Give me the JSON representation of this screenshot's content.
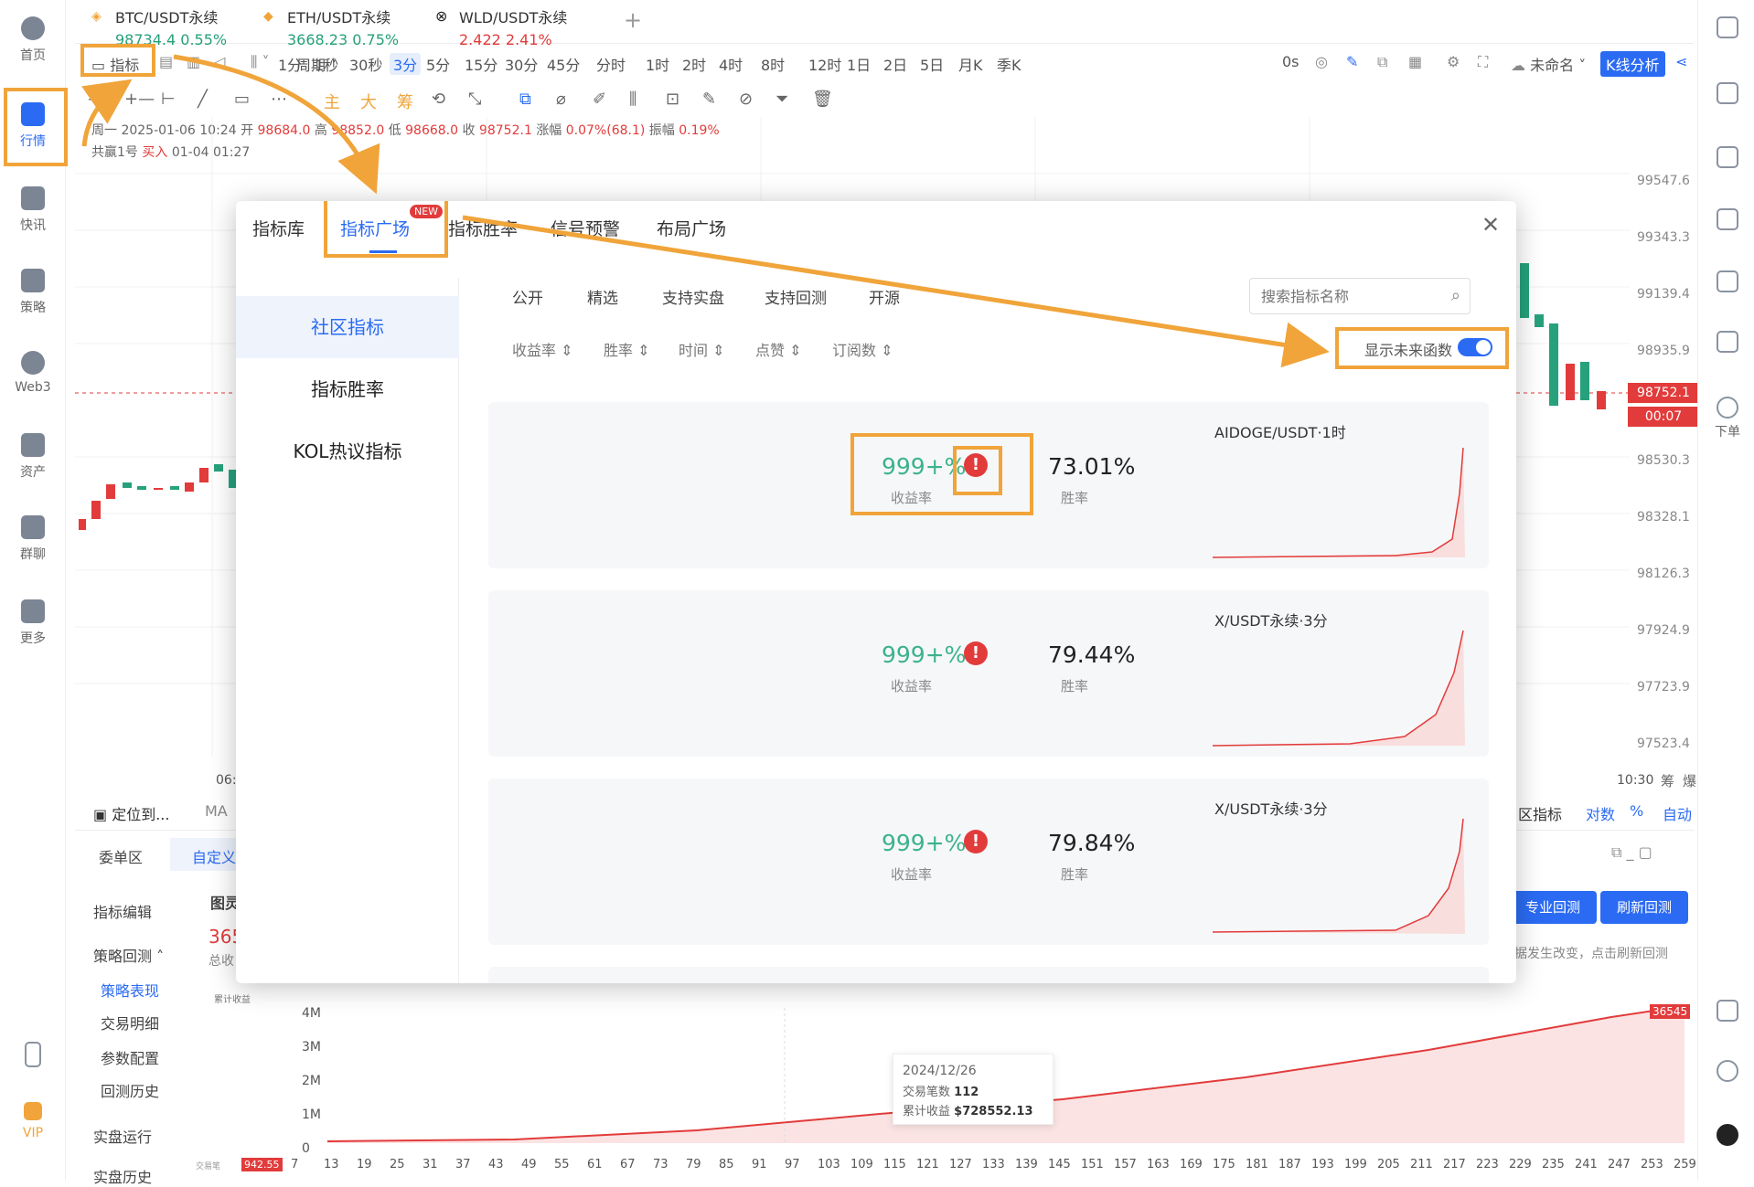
{
  "nav": [
    {
      "label": "首页"
    },
    {
      "label": "行情"
    },
    {
      "label": "快讯"
    },
    {
      "label": "策略"
    },
    {
      "label": "Web3"
    },
    {
      "label": "资产"
    },
    {
      "label": "群聊"
    },
    {
      "label": "更多"
    },
    {
      "label": "VIP"
    }
  ],
  "tabs": [
    {
      "name": "BTC/USDT永续",
      "price": "98734.4",
      "change": "0.55%"
    },
    {
      "name": "ETH/USDT永续",
      "price": "3668.23",
      "change": "0.75%"
    },
    {
      "name": "WLD/USDT永续",
      "price": "2.422",
      "change": "2.41%"
    }
  ],
  "toolbar": {
    "indicator": "指标",
    "period": "周期",
    "intervals": [
      "1分",
      "1秒",
      "30秒",
      "3分",
      "5分",
      "15分",
      "30分",
      "45分",
      "分时",
      "1时",
      "2时",
      "4时",
      "8时",
      "12时",
      "1日",
      "2日",
      "5日",
      "月K",
      "季K"
    ],
    "countdown": "0s",
    "unnamed": "未命名",
    "kline": "K线分析"
  },
  "toolbar2": {
    "zhu": "主",
    "da": "大",
    "chou": "筹"
  },
  "info": {
    "line1_date": "周一 2025-01-06 10:24",
    "open_label": "开",
    "open": "98684.0",
    "high_label": "高",
    "high": "98852.0",
    "low_label": "低",
    "low": "98668.0",
    "close_label": "收",
    "close": "98752.1",
    "chg_label": "涨幅",
    "chg": "0.07%(68.1)",
    "amp_label": "振幅",
    "amp": "0.19%",
    "line2": "共赢1号",
    "buy": "买入",
    "line2_date": "01-04 01:27"
  },
  "axis": {
    "prices": [
      "99547.6",
      "99343.3",
      "99139.4",
      "98935.9",
      "98530.3",
      "98328.1",
      "98126.3",
      "97924.9",
      "97723.9",
      "97523.4"
    ],
    "current": "98752.1",
    "timer": "00:07",
    "time_left": "06:",
    "time_right": "10:30",
    "chou": "筹",
    "bao": "爆"
  },
  "chart_footer": {
    "locate": "定位到...",
    "ma": "MA",
    "community": "区指标",
    "log": "对数",
    "pct": "%",
    "auto": "自动"
  },
  "bottom": {
    "tab1": "委单区",
    "tab2": "自定义",
    "edit": "指标编辑",
    "backtest": "策略回测",
    "perf": "策略表现",
    "trades": "交易明细",
    "params": "参数配置",
    "history": "回测历史",
    "live": "实盘运行",
    "live_hist": "实盘历史",
    "chart_title": "图灵",
    "total": "365",
    "total_label": "总收",
    "btn_pro": "专业回测",
    "btn_refresh": "刷新回测",
    "note": "据发生改变，点击刷新回测",
    "y_title": "累计收益",
    "y_ticks": [
      "4M",
      "3M",
      "2M",
      "1M",
      "0"
    ],
    "x_ticks": [
      "7",
      "13",
      "19",
      "25",
      "31",
      "37",
      "43",
      "49",
      "55",
      "61",
      "67",
      "73",
      "79",
      "85",
      "91",
      "97",
      "103",
      "109",
      "115",
      "121",
      "127",
      "133",
      "139",
      "145",
      "151",
      "157",
      "163",
      "169",
      "175",
      "181",
      "187",
      "193",
      "199",
      "205",
      "211",
      "217",
      "223",
      "229",
      "235",
      "241",
      "247",
      "253",
      "259"
    ],
    "x_first": "942.55",
    "x_label": "交易笔",
    "end_label": "36545",
    "tooltip": {
      "date": "2024/12/26",
      "trades_label": "交易笔数",
      "trades": "112",
      "profit_label": "累计收益",
      "profit": "$728552.13"
    }
  },
  "modal": {
    "tabs": [
      "指标库",
      "指标广场",
      "指标胜率",
      "信号预警",
      "布局广场"
    ],
    "new_badge": "NEW",
    "side": [
      "社区指标",
      "指标胜率",
      "KOL热议指标"
    ],
    "filters": [
      "公开",
      "精选",
      "支持实盘",
      "支持回测",
      "开源"
    ],
    "search_placeholder": "搜索指标名称",
    "sorts": [
      "收益率",
      "胜率",
      "时间",
      "点赞",
      "订阅数"
    ],
    "future_toggle": "显示未来函数",
    "cards": [
      {
        "ret": "999+%",
        "ret_label": "收益率",
        "win": "73.01%",
        "win_label": "胜率",
        "pair": "AIDOGE/USDT·1时"
      },
      {
        "ret": "999+%",
        "ret_label": "收益率",
        "win": "79.44%",
        "win_label": "胜率",
        "pair": "X/USDT永续·3分"
      },
      {
        "ret": "999+%",
        "ret_label": "收益率",
        "win": "79.84%",
        "win_label": "胜率",
        "pair": "X/USDT永续·3分"
      }
    ]
  },
  "right": {
    "order": "下单"
  },
  "colors": {
    "accent": "#2b6bf3",
    "up": "#26a17b",
    "down": "#e23b3b",
    "highlight": "#f0a43a"
  }
}
